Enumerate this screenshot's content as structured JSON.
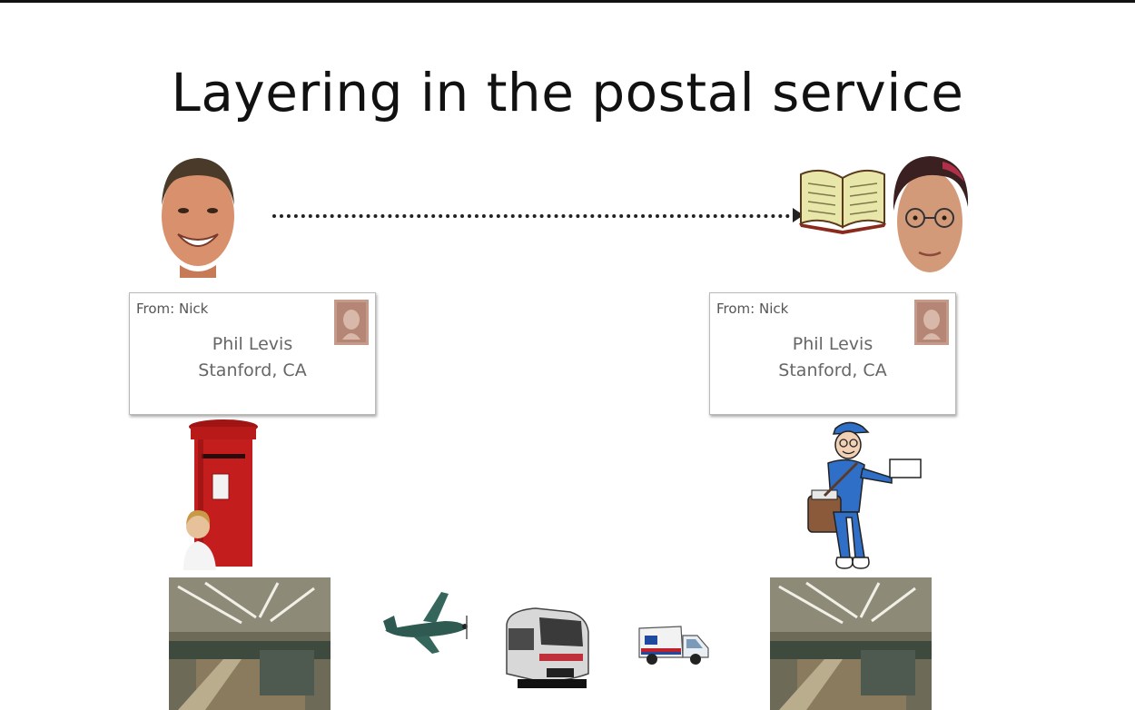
{
  "slide": {
    "title": "Layering in the postal service"
  },
  "envelopes": [
    {
      "from": "From: Nick",
      "name": "Phil Levis",
      "address": "Stanford, CA"
    },
    {
      "from": "From: Nick",
      "name": "Phil Levis",
      "address": "Stanford, CA"
    }
  ],
  "icons": {
    "sender": "sender-face-photo",
    "receiver": "receiver-face-photo",
    "book": "book-icon",
    "postbox": "post-box-photo",
    "mailman": "mail-carrier-icon",
    "sorting_facility": "sorting-facility-photo",
    "airplane": "airplane-icon",
    "train": "train-icon",
    "truck": "mail-truck-icon"
  },
  "colors": {
    "title": "#111111",
    "postbox_red": "#c41d1d",
    "mailman_blue": "#2f6fc7"
  }
}
